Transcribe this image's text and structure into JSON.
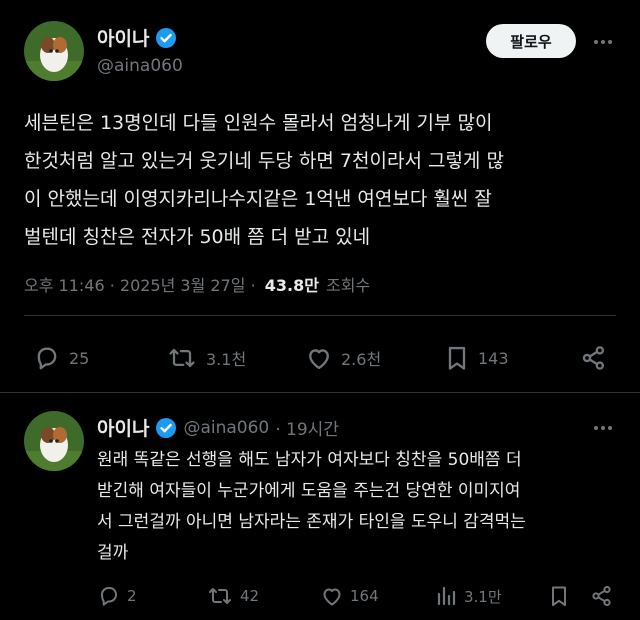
{
  "main_tweet": {
    "display_name": "아이나",
    "handle": "@aina060",
    "follow_label": "팔로우",
    "text_lines": [
      "세븐틴은 13명인데 다들 인원수 몰라서 엄청나게 기부 많이",
      "한것처럼 알고 있는거 웃기네 두당 하면 7천이라서 그렇게 많",
      "이 안했는데 이영지카리나수지같은 1억낸 여연보다 훨씬 잘",
      "벌텐데 칭찬은 전자가 50배 쯤 더 받고 있네"
    ],
    "timestamp": "오후 11:46 · 2025년 3월 27일 ·",
    "views_count": "43.8만",
    "views_label": "조회수",
    "stats": {
      "replies": "25",
      "retweets": "3.1천",
      "likes": "2.6천",
      "bookmarks": "143"
    }
  },
  "reply": {
    "display_name": "아이나",
    "handle": "@aina060",
    "time": "· 19시간",
    "text_lines": [
      "원래 똑같은 선행을 해도 남자가 여자보다 칭찬을 50배쯤 더",
      "받긴해 여자들이 누군가에게 도움을 주는건 당연한 이미지여",
      "서 그런걸까 아니면 남자라는 존재가 타인을 도우니 감격먹는",
      "걸까"
    ],
    "stats": {
      "replies": "2",
      "retweets": "42",
      "likes": "164",
      "views": "3.1만"
    }
  },
  "colors": {
    "verified": "#1d9bf0",
    "muted": "#71767b",
    "text": "#e7e9ea",
    "divider": "#2f3336"
  },
  "icons": [
    "verified-badge-icon",
    "more-icon",
    "reply-icon",
    "retweet-icon",
    "like-icon",
    "bookmark-icon",
    "share-icon",
    "views-icon"
  ]
}
